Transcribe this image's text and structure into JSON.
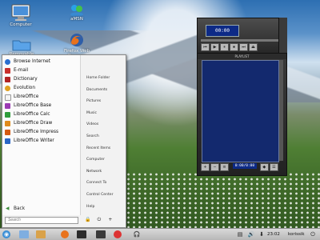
{
  "desktop": {
    "icons": [
      {
        "label": "Computer"
      },
      {
        "label": "aMSN"
      },
      {
        "label": "Removable Media"
      },
      {
        "label": "Firefox Web Browser"
      }
    ]
  },
  "start_menu": {
    "favorites": [
      {
        "label": "Browse Internet",
        "icon": "globe-icon",
        "color": "#2b6fd0"
      },
      {
        "label": "E-mail",
        "icon": "mail-icon",
        "color": "#c9302c"
      },
      {
        "label": "Dictionary",
        "icon": "dictionary-icon",
        "color": "#b12424"
      },
      {
        "label": "Evolution",
        "icon": "evolution-icon",
        "color": "#e0a020"
      },
      {
        "label": "LibreOffice",
        "icon": "libreoffice-icon",
        "color": "#f4f4f4"
      },
      {
        "label": "LibreOffice Base",
        "icon": "base-icon",
        "color": "#9b3bb4"
      },
      {
        "label": "LibreOffice Calc",
        "icon": "calc-icon",
        "color": "#2f9d3b"
      },
      {
        "label": "LibreOffice Draw",
        "icon": "draw-icon",
        "color": "#e08b1c"
      },
      {
        "label": "LibreOffice Impress",
        "icon": "impress-icon",
        "color": "#d45a12"
      },
      {
        "label": "LibreOffice Writer",
        "icon": "writer-icon",
        "color": "#2a66c6"
      }
    ],
    "places": [
      "Home Folder",
      "Documents",
      "Pictures",
      "Music",
      "Videos",
      "Search",
      "Recent Items",
      "Computer",
      "Network",
      "Connect To",
      "Control Center",
      "Help"
    ],
    "back_label": "Back",
    "search_placeholder": "Search"
  },
  "media_player": {
    "time": "00:00",
    "playlist_title": "PLAYLIST",
    "playlist_time": "0:00/0:00"
  },
  "taskbar": {
    "clock": "23:02",
    "user": "korissik"
  }
}
